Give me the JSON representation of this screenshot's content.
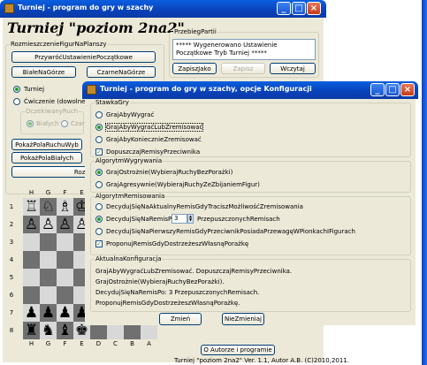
{
  "main": {
    "title": "Turniej - program do gry w szachy",
    "heading": "Turniej  \"poziom 2na2\"",
    "placement_group": "RozmieszczenieFigurNaPlanszy",
    "btn_default_setup": "PrzywróćUstawieniePoczątkowe",
    "btn_white_top": "BiałeNaGórze",
    "btn_black_top": "CzarneNaGórze",
    "radio_tournament": "Turniej",
    "radio_exercise": "Ćwiczenie (dowolne roz",
    "waiting_move": "OczekiwanyRuch",
    "radio_white": "Białych",
    "radio_black": "Czarn",
    "btn_show_moves": "PokażPolaRuchuWyb",
    "btn_show_white_fields": "PokażPolaBiałych",
    "btn_start": "Rozpo",
    "game_group": "PrzebiegPartii",
    "game_log": "***** Wygenerowano Ustawienie Początkowe Tryb Turniej *****",
    "btn_save": "ZapiszJako",
    "btn_write": "Zapisz",
    "btn_load": "Wczytaj",
    "files": [
      "H",
      "G",
      "F",
      "E",
      "D",
      "C",
      "B",
      "A"
    ],
    "ranks": [
      "1",
      "2",
      "3",
      "4",
      "5",
      "6",
      "7",
      "8"
    ],
    "board_rows": [
      [
        "♖",
        "♘",
        "♗",
        "♔",
        "",
        "",
        "",
        ""
      ],
      [
        "♙",
        "♙",
        "♙",
        "♙",
        "",
        "",
        "",
        ""
      ],
      [
        "",
        "",
        "",
        "",
        "",
        "",
        "",
        ""
      ],
      [
        "",
        "",
        "",
        "",
        "",
        "",
        "",
        ""
      ],
      [
        "",
        "",
        "",
        "",
        "",
        "",
        "",
        ""
      ],
      [
        "",
        "",
        "",
        "",
        "",
        "",
        "",
        ""
      ],
      [
        "♟",
        "♟",
        "♟",
        "♟",
        "",
        "",
        "",
        ""
      ],
      [
        "♜",
        "♞",
        "♝",
        "♚",
        "",
        "",
        "",
        ""
      ]
    ],
    "btn_about": "O Autorze i programie",
    "footer": "Turniej \"poziom 2na2\" Ver. 1.1, Autor A.B. (C)2010,2011."
  },
  "dialog": {
    "title": "Turniej - program do gry w szachy, opcje Konfiguracji",
    "stake_group": "StawkaGry",
    "stake_options": [
      {
        "label": "GrajAbyWygrać",
        "checked": false
      },
      {
        "label": "GrajAbyWygraćLubZremisować",
        "checked": true
      },
      {
        "label": "GrajAbyKoniecznieZremisować",
        "checked": false
      }
    ],
    "accept_draw": "DopuszczajRemisyPrzeciwnika",
    "accept_draw_checked": true,
    "win_group": "AlgorytmWygrywania",
    "win_options": [
      {
        "label": "GrajOstrożnie(WybierajRuchyBezPorażki)",
        "checked": true
      },
      {
        "label": "GrajAgresywnie(WybierajRuchyZeZbijaniemFigur)",
        "checked": false
      }
    ],
    "draw_group": "AlgorytmRemisowania",
    "draw_opt1": "DecydujSięNaAktualnyRemisGdyTraciszMożliwośćZremisowania",
    "draw_opt2_prefix": "DecydujSięNaRemisPo:",
    "draw_opt2_value": "3",
    "draw_opt2_suffix": "PrzepuszczonychRemisach",
    "draw_opt3": "DecydujSięNaPierwszyRemisGdyPrzeciwnikPosiadaPrzewagęWPionkachIFigurach",
    "propose_draw": "ProponujRemisGdyDostrzeżeszWłasnąPorażkę",
    "propose_draw_checked": true,
    "current_group": "AktualnaKonfiguracja",
    "current_lines": [
      "GrajAbyWygraćLubZremisować. DopuszczajRemisyPrzeciwnika.",
      "GrajOstrożnie(WybierajRuchyBezPorażki).",
      "DecydujSięNaRemisPo: 3 PrzepuszczonychRemisach.",
      "ProponujRemisGdyDostrzeżeszWłasnąPorażkę."
    ],
    "btn_change": "Zmień",
    "btn_nochange": "NieZmieniaj"
  }
}
